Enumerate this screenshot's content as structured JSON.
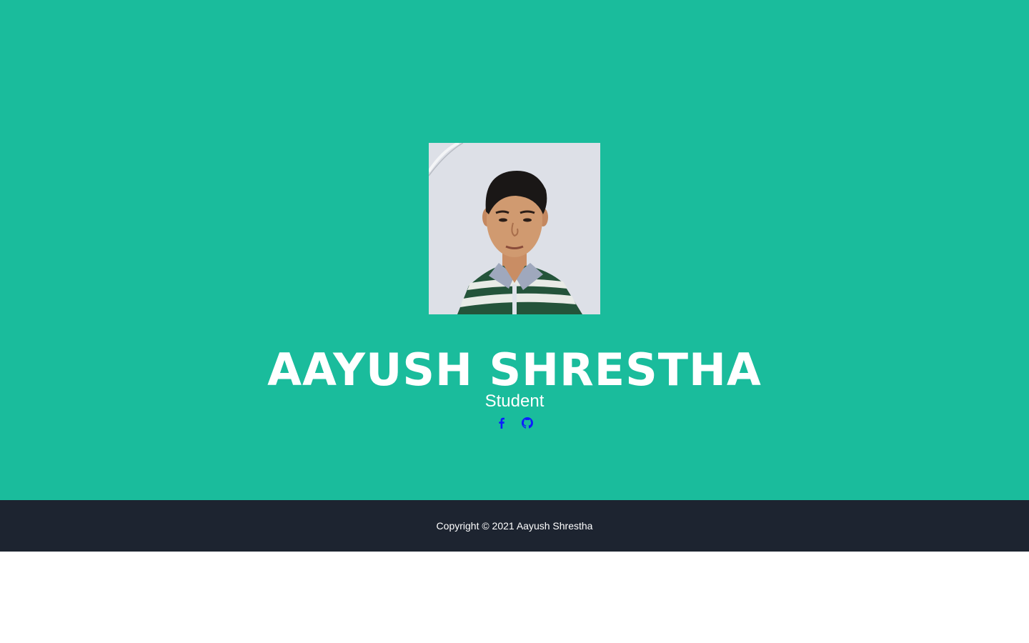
{
  "colors": {
    "masthead_bg": "#1abc9c",
    "footer_bg": "#1d2430",
    "social_icon": "#0d1cff",
    "text": "#ffffff"
  },
  "profile": {
    "photo_alt": "Aayush Shrestha",
    "name": "AAYUSH SHRESTHA",
    "role": "Student"
  },
  "social": [
    {
      "icon": "facebook-icon"
    },
    {
      "icon": "github-icon"
    }
  ],
  "footer": {
    "copyright": "Copyright © 2021 Aayush Shrestha"
  }
}
